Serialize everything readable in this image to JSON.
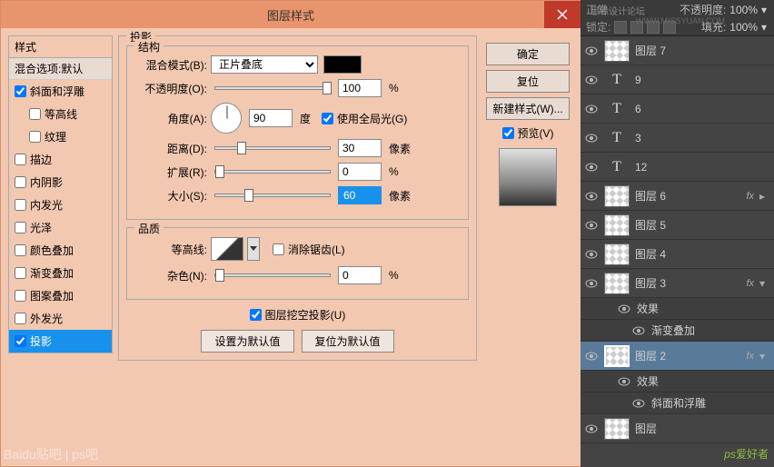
{
  "dialog": {
    "title": "图层样式",
    "styles": {
      "header": "样式",
      "blending_default": "混合选项:默认",
      "items": [
        {
          "label": "斜面和浮雕",
          "checked": true,
          "indent": false
        },
        {
          "label": "等高线",
          "checked": false,
          "indent": true
        },
        {
          "label": "纹理",
          "checked": false,
          "indent": true
        },
        {
          "label": "描边",
          "checked": false,
          "indent": false
        },
        {
          "label": "内阴影",
          "checked": false,
          "indent": false
        },
        {
          "label": "内发光",
          "checked": false,
          "indent": false
        },
        {
          "label": "光泽",
          "checked": false,
          "indent": false
        },
        {
          "label": "颜色叠加",
          "checked": false,
          "indent": false
        },
        {
          "label": "渐变叠加",
          "checked": false,
          "indent": false
        },
        {
          "label": "图案叠加",
          "checked": false,
          "indent": false
        },
        {
          "label": "外发光",
          "checked": false,
          "indent": false
        },
        {
          "label": "投影",
          "checked": true,
          "indent": false,
          "selected": true
        }
      ]
    },
    "shadow": {
      "section_title": "投影",
      "structure_title": "结构",
      "blend_mode_label": "混合模式(B):",
      "blend_mode_value": "正片叠底",
      "opacity_label": "不透明度(O):",
      "opacity_value": "100",
      "opacity_unit": "%",
      "angle_label": "角度(A):",
      "angle_value": "90",
      "angle_unit": "度",
      "global_light_label": "使用全局光(G)",
      "global_light_checked": true,
      "distance_label": "距离(D):",
      "distance_value": "30",
      "distance_unit": "像素",
      "spread_label": "扩展(R):",
      "spread_value": "0",
      "spread_unit": "%",
      "size_label": "大小(S):",
      "size_value": "60",
      "size_unit": "像素",
      "quality_title": "品质",
      "contour_label": "等高线:",
      "antialias_label": "消除锯齿(L)",
      "antialias_checked": false,
      "noise_label": "杂色(N):",
      "noise_value": "0",
      "noise_unit": "%",
      "knockout_label": "图层挖空投影(U)",
      "knockout_checked": true,
      "set_default": "设置为默认值",
      "reset_default": "复位为默认值"
    },
    "actions": {
      "ok": "确定",
      "cancel": "复位",
      "new_style": "新建样式(W)...",
      "preview": "预览(V)",
      "preview_checked": true
    }
  },
  "layers": {
    "top": {
      "mode": "正常",
      "opacity_label": "不透明度:",
      "opacity_value": "100%",
      "lock_label": "锁定:",
      "fill_label": "填充:",
      "fill_value": "100%"
    },
    "items": [
      {
        "type": "raster",
        "name": "图层 7"
      },
      {
        "type": "text",
        "name": "9"
      },
      {
        "type": "text",
        "name": "6"
      },
      {
        "type": "text",
        "name": "3"
      },
      {
        "type": "text",
        "name": "12"
      },
      {
        "type": "raster",
        "name": "图层 6",
        "fx": true
      },
      {
        "type": "raster",
        "name": "图层 5"
      },
      {
        "type": "raster",
        "name": "图层 4"
      },
      {
        "type": "raster",
        "name": "图层 3",
        "fx": true,
        "expanded": true
      },
      {
        "type": "sub",
        "name": "效果"
      },
      {
        "type": "sub2",
        "name": "渐变叠加"
      },
      {
        "type": "raster",
        "name": "图层 2",
        "fx": true,
        "expanded": true,
        "selected": true
      },
      {
        "type": "sub",
        "name": "效果"
      },
      {
        "type": "sub2",
        "name": "斜面和浮雕"
      },
      {
        "type": "raster",
        "name": "图层"
      }
    ]
  },
  "watermarks": {
    "bottom_left": "Baidu贴吧 | ps吧",
    "bottom_right_ps": "ps",
    "bottom_right_han": "爱好者",
    "top_brand": "思缘设计论坛",
    "top_url": "WWW.MISSYUAN.COM"
  }
}
